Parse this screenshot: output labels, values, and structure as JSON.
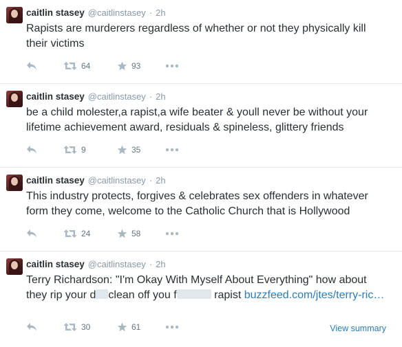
{
  "colors": {
    "link": "#2b7bb9",
    "action_icon": "#aab8c2",
    "meta": "#8899a6",
    "text": "#292f33"
  },
  "tweets": [
    {
      "fullname": "caitlin stasey",
      "username": "@caitlinstasey",
      "separator": "·",
      "time": "2h",
      "text": "Rapists are murderers regardless of whether or not they physically kill their victims",
      "retweets": "64",
      "favorites": "93"
    },
    {
      "fullname": "caitlin stasey",
      "username": "@caitlinstasey",
      "separator": "·",
      "time": "2h",
      "text": "be a child molester,a rapist,a wife beater & youll never be without your lifetime achievement award, residuals & spineless, glittery friends",
      "retweets": "9",
      "favorites": "35"
    },
    {
      "fullname": "caitlin stasey",
      "username": "@caitlinstasey",
      "separator": "·",
      "time": "2h",
      "text": "This industry protects, forgives & celebrates sex offenders in whatever form they come, welcome to the Catholic Church that is Hollywood",
      "retweets": "24",
      "favorites": "58"
    },
    {
      "fullname": "caitlin stasey",
      "username": "@caitlinstasey",
      "separator": "·",
      "time": "2h",
      "text_part1": "Terry Richardson: \"I'm Okay With Myself About Everything\" how about they rip your d",
      "text_part2": "clean off you f",
      "text_part3": " rapist ",
      "link": "buzzfeed.com/jtes/terry-ric…",
      "retweets": "30",
      "favorites": "61",
      "view_summary": "View summary"
    }
  ]
}
